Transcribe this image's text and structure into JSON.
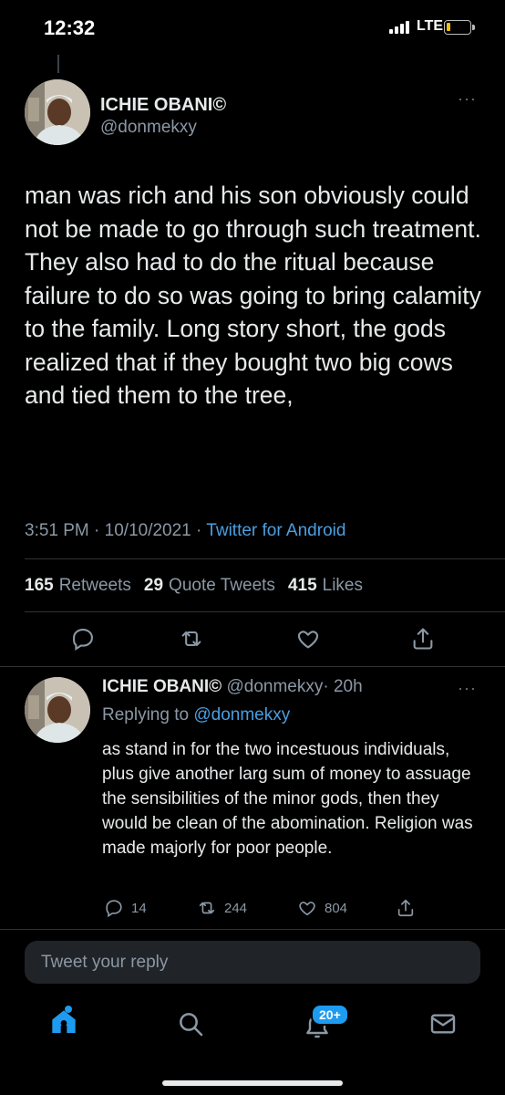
{
  "status_bar": {
    "time": "12:32",
    "network": "LTE",
    "battery_color": "#f2c200"
  },
  "main_tweet": {
    "author_name": "ICHIE OBANI©",
    "author_handle": "@donmekxy",
    "text": "man was rich and his son obviously could not be made to go through such treatment. They also had to do the ritual because failure to do so was going to bring calamity to the family. Long story short, the gods realized that if they bought two big cows and tied them to the tree,",
    "time": "3:51 PM",
    "date": "10/10/2021",
    "separator": "·",
    "source": "Twitter for Android",
    "stats": {
      "retweets_count": "165",
      "retweets_label": "Retweets",
      "quotes_count": "29",
      "quotes_label": "Quote Tweets",
      "likes_count": "415",
      "likes_label": "Likes"
    },
    "actions": [
      "reply-icon",
      "retweet-icon",
      "like-icon",
      "share-icon"
    ]
  },
  "reply_tweet": {
    "author_name": "ICHIE OBANI©",
    "author_handle": "@donmekxy",
    "age": "· 20h",
    "replying_prefix": "Replying to",
    "replying_to": "@donmekxy",
    "text": "as stand in for the two incestuous individuals, plus give another larg sum of money to assuage the sensibilities of the minor gods, then they would be clean of the abomination. Religion was made majorly for poor people.",
    "reply_count": "14",
    "retweet_count": "244",
    "like_count": "804"
  },
  "compose": {
    "placeholder": "Tweet your reply"
  },
  "bottom_nav": {
    "items": [
      "home-icon",
      "search-icon",
      "notifications-icon",
      "messages-icon"
    ],
    "notification_badge": "20+",
    "accent_color": "#1d9bf0"
  },
  "more_glyph": "···"
}
